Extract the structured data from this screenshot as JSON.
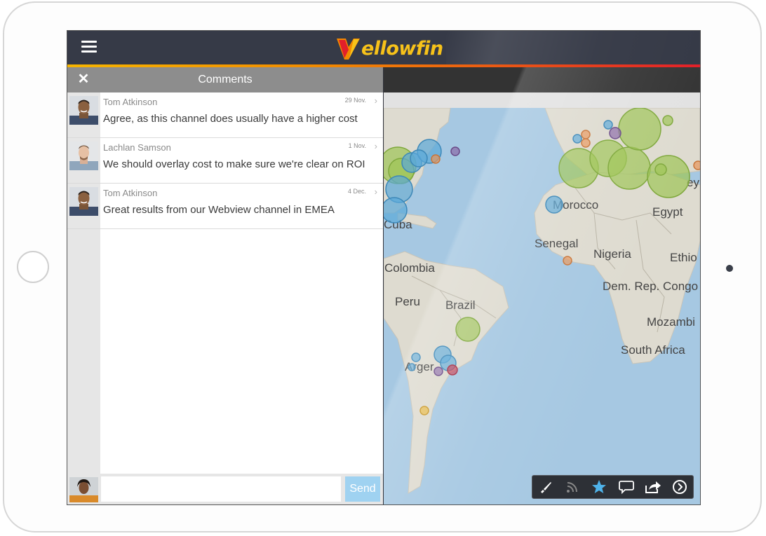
{
  "app": {
    "logo_text": "ellowfin",
    "brand_color": "#f7c21a"
  },
  "comments_panel": {
    "title": "Comments",
    "comments": [
      {
        "author": "Tom Atkinson",
        "date": "29 Nov.",
        "text": "Agree, as this channel does usually have a higher cost"
      },
      {
        "author": "Lachlan Samson",
        "date": "1 Nov.",
        "text": "We should overlay cost to make sure we're clear on ROI"
      },
      {
        "author": "Tom Atkinson",
        "date": "4 Dec.",
        "text": "Great results from our Webview channel in EMEA"
      }
    ],
    "input": {
      "value": "",
      "placeholder": ""
    },
    "send_label": "Send"
  },
  "map": {
    "labels": [
      "Morocco",
      "Egypt",
      "Senegal",
      "Nigeria",
      "Ethio",
      "Colombia",
      "Dem. Rep. Congo",
      "Peru",
      "Brazil",
      "Mozambi",
      "South Africa",
      "Cuba",
      "Arger",
      "ey"
    ],
    "colors": {
      "ocean": "#a6c8e2",
      "land": "#dedbd0",
      "green": "#9ec455",
      "blue": "#5aa8d8",
      "orange": "#e8955a",
      "purple": "#8a6aa8",
      "red": "#c43c52",
      "yellow": "#e8b83a"
    }
  },
  "toolbar": {
    "icons": [
      "brush-icon",
      "rss-icon",
      "star-icon",
      "comment-icon",
      "share-icon",
      "next-icon"
    ]
  }
}
